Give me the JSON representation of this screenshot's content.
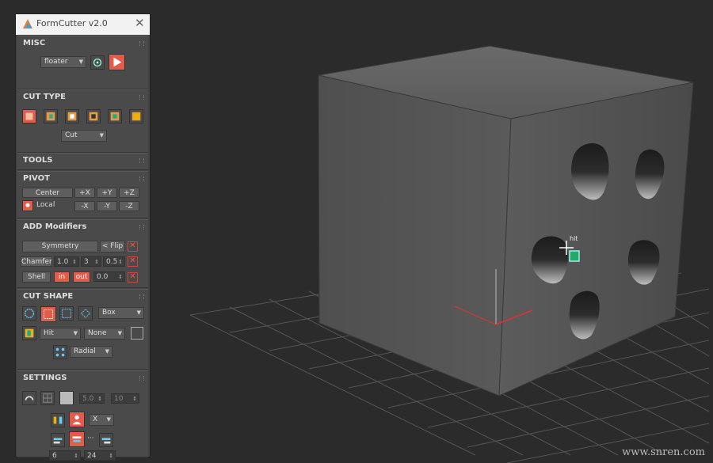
{
  "app": {
    "title": "FormCutter v2.0",
    "close_glyph": "✕"
  },
  "misc": {
    "header": "MISC",
    "mode_value": "floater",
    "icons": [
      "target-icon",
      "play-icon"
    ]
  },
  "cut_type": {
    "header": "CUT TYPE",
    "op_value": "Cut",
    "icons": [
      "cut-icon",
      "slice-icon",
      "union-icon",
      "intersect-icon",
      "split-icon",
      "merge-icon"
    ]
  },
  "tools": {
    "header": "TOOLS"
  },
  "pivot": {
    "header": "PIVOT",
    "center": "Center",
    "local": "Local",
    "plus": [
      "+X",
      "+Y",
      "+Z"
    ],
    "minus": [
      "-X",
      "-Y",
      "-Z"
    ]
  },
  "modifiers": {
    "header": "ADD Modifiers",
    "symmetry": "Symmetry",
    "flip": "< Flip",
    "chamfer": "Chamfer",
    "chamfer_vals": [
      "1.0",
      "3",
      "0.5"
    ],
    "shell": "Shell",
    "in": "in",
    "out": "out",
    "shell_val": "0.0"
  },
  "cut_shape": {
    "header": "CUT SHAPE",
    "shape_value": "Box",
    "hit_value": "Hit",
    "none_value": "None",
    "radial": "Radial"
  },
  "settings": {
    "header": "SETTINGS",
    "spin1": "5.0",
    "spin2": "10",
    "axis_value": "X",
    "count1": "6",
    "count2": "24"
  },
  "viewport": {
    "hit_label": "hit"
  },
  "watermark": "www.snren.com"
}
